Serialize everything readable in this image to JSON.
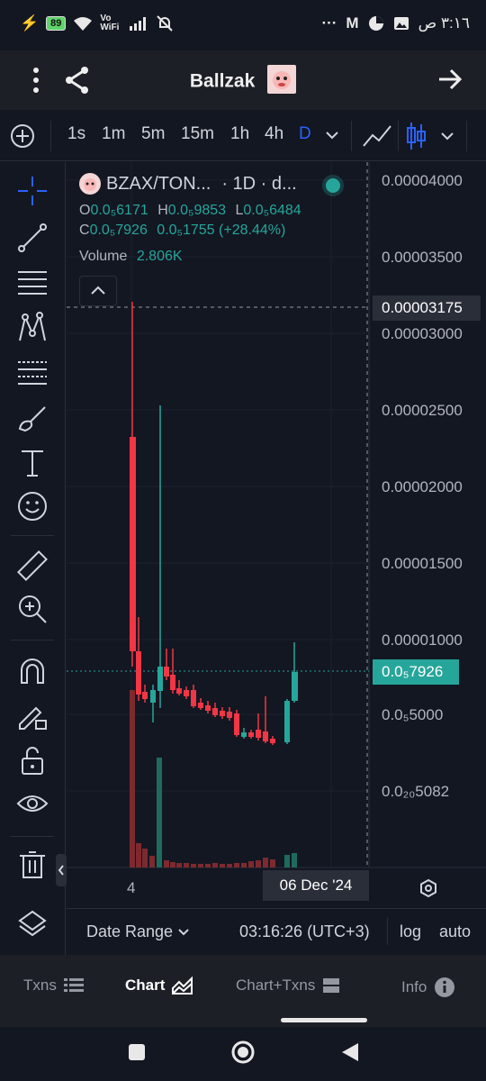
{
  "status_bar": {
    "battery": "89",
    "network": "Vo WiFi",
    "time": "٣:١٦ ص",
    "dots": "···"
  },
  "header": {
    "title": "Ballzak"
  },
  "timeframes": [
    {
      "label": "1s",
      "active": false
    },
    {
      "label": "1m",
      "active": false
    },
    {
      "label": "5m",
      "active": false
    },
    {
      "label": "15m",
      "active": false
    },
    {
      "label": "1h",
      "active": false
    },
    {
      "label": "4h",
      "active": false
    },
    {
      "label": "D",
      "active": true
    }
  ],
  "legend": {
    "symbol": "BZAX/TON...",
    "interval": "· 1D · d...",
    "o_label": "O",
    "o_value": "0.0₅6171",
    "h_label": "H",
    "h_value": "0.0₅9853",
    "l_label": "L",
    "l_value": "0.0₅6484",
    "c_label": "C",
    "c_value": "0.0₅7926",
    "change": "0.0₅1755 (+28.44%)",
    "volume_label": "Volume",
    "volume_value": "2.806K"
  },
  "price_axis": [
    "0.00004000",
    "0.00003500",
    "0.00003000",
    "0.00002500",
    "0.00002000",
    "0.00001500",
    "0.00001000",
    "0.0₅5000",
    "0.0₂₀5082"
  ],
  "crosshair_price": "0.00003175",
  "last_price": "0.0₅7926",
  "time_axis": {
    "tick": "4",
    "crosshair_date": "06 Dec '24"
  },
  "chart_footer": {
    "date_range": "Date Range",
    "time": "03:16:26 (UTC+3)",
    "log": "log",
    "auto": "auto"
  },
  "bottom_nav": {
    "txns": "Txns",
    "chart": "Chart",
    "chart_txns": "Chart+Txns",
    "info": "Info"
  },
  "colors": {
    "up": "#26a69a",
    "down": "#f23645",
    "accent": "#2962ff"
  }
}
